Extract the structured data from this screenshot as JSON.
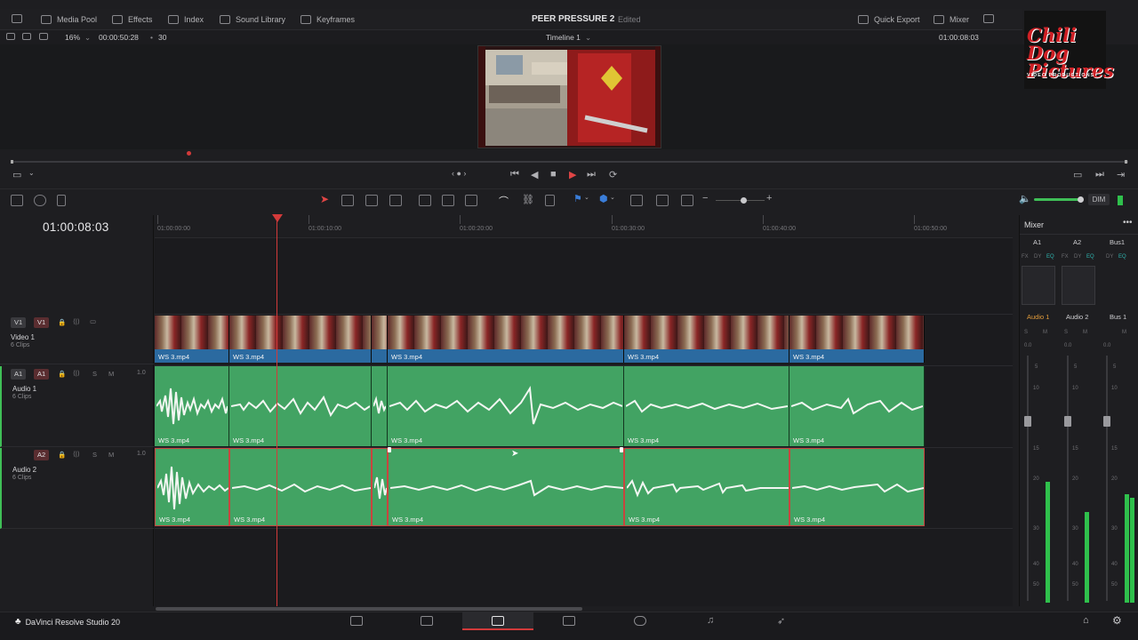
{
  "topbar": {
    "media_pool": "Media Pool",
    "effects": "Effects",
    "index": "Index",
    "sound_library": "Sound Library",
    "keyframes": "Keyframes",
    "project_title": "PEER PRESSURE 2",
    "project_status": "Edited",
    "quick_export": "Quick Export",
    "mixer": "Mixer"
  },
  "subbar": {
    "zoom": "16%",
    "duration": "00:00:50:28",
    "fps": "30",
    "timeline_name": "Timeline 1",
    "timecode_right": "01:00:08:03"
  },
  "logo": {
    "line1": "Chili Dog",
    "line2": "Pictures",
    "line3": "VIDEO PRODUCTIONS"
  },
  "toolbar": {
    "dim_label": "DIM"
  },
  "timeline": {
    "current_timecode": "01:00:08:03",
    "ruler": [
      "01:00:00:00",
      "01:00:10:00",
      "01:00:20:00",
      "01:00:30:00",
      "01:00:40:00",
      "01:00:50:00"
    ],
    "tracks": {
      "v1": {
        "chip_a": "V1",
        "chip_b": "V1",
        "name": "Video 1",
        "count": "6 Clips"
      },
      "a1": {
        "chip_a": "A1",
        "chip_b": "A1",
        "name": "Audio 1",
        "count": "6 Clips",
        "vol": "1.0",
        "solo": "S",
        "mute": "M"
      },
      "a2": {
        "chip": "A2",
        "name": "Audio 2",
        "count": "6 Clips",
        "vol": "1.0",
        "solo": "S",
        "mute": "M"
      }
    },
    "clip_label": "WS 3.mp4"
  },
  "mixer": {
    "title": "Mixer",
    "columns": [
      "A1",
      "A2",
      "Bus1"
    ],
    "fx_labels": [
      "FX",
      "DY",
      "EQ"
    ],
    "channel_names": [
      "Audio 1",
      "Audio 2",
      "Bus 1"
    ],
    "gain_values": [
      "0.0",
      "0.0",
      "0.0"
    ],
    "scale": [
      "0",
      "5",
      "10",
      "15",
      "20",
      "30",
      "40",
      "50"
    ]
  },
  "bottombar": {
    "brand": "DaVinci Resolve Studio 20"
  }
}
